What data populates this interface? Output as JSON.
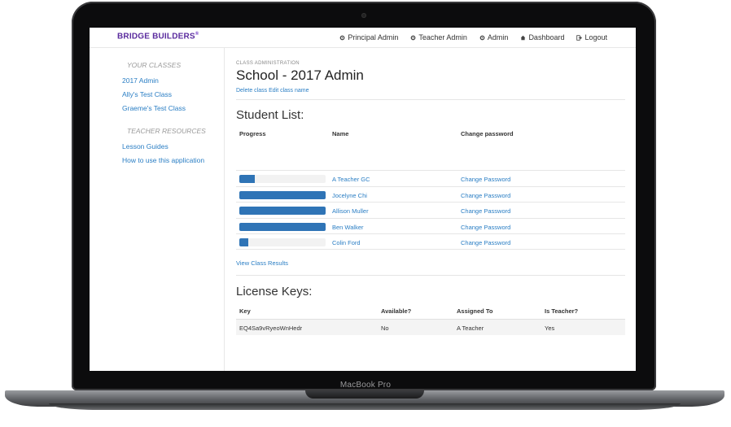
{
  "device": {
    "label": "MacBook Pro"
  },
  "topnav": {
    "brand": "BRIDGE BUILDERS",
    "brand_mark": "®",
    "links": [
      {
        "label": "Principal Admin",
        "icon": "gear-icon"
      },
      {
        "label": "Teacher Admin",
        "icon": "gear-icon"
      },
      {
        "label": "Admin",
        "icon": "gear-icon"
      },
      {
        "label": "Dashboard",
        "icon": "home-icon"
      },
      {
        "label": "Logout",
        "icon": "logout-icon"
      }
    ]
  },
  "sidebar": {
    "classes_heading": "YOUR CLASSES",
    "classes": [
      "2017 Admin",
      "Ally's Test Class",
      "Graeme's Test Class"
    ],
    "resources_heading": "TEACHER RESOURCES",
    "resources": [
      "Lesson Guides",
      "How to use this application"
    ]
  },
  "main": {
    "eyebrow": "CLASS ADMINISTRATION",
    "title": "School - 2017 Admin",
    "delete_link": "Delete class",
    "edit_link": "Edit class name",
    "student_list_title": "Student List:",
    "student_columns": [
      "Progress",
      "Name",
      "Change password"
    ],
    "students": [
      {
        "name": "A Teacher GC",
        "progress": 0.18,
        "action": "Change Password"
      },
      {
        "name": "Jocelyne Chi",
        "progress": 1.0,
        "action": "Change Password"
      },
      {
        "name": "Allison Muller",
        "progress": 1.0,
        "action": "Change Password"
      },
      {
        "name": "Ben Walker",
        "progress": 1.0,
        "action": "Change Password"
      },
      {
        "name": "Colin Ford",
        "progress": 0.1,
        "action": "Change Password"
      }
    ],
    "view_results": "View Class Results",
    "license_title": "License Keys:",
    "license_columns": [
      "Key",
      "Available?",
      "Assigned To",
      "Is Teacher?"
    ],
    "license_rows": [
      {
        "key": "EQ4Sa9vRyeoWnHedr",
        "available": "No",
        "assigned_to": "A Teacher",
        "is_teacher": "Yes"
      }
    ]
  },
  "colors": {
    "brand": "#5a2b9e",
    "link": "#2a7ec4",
    "progress": "#2f74b6"
  }
}
